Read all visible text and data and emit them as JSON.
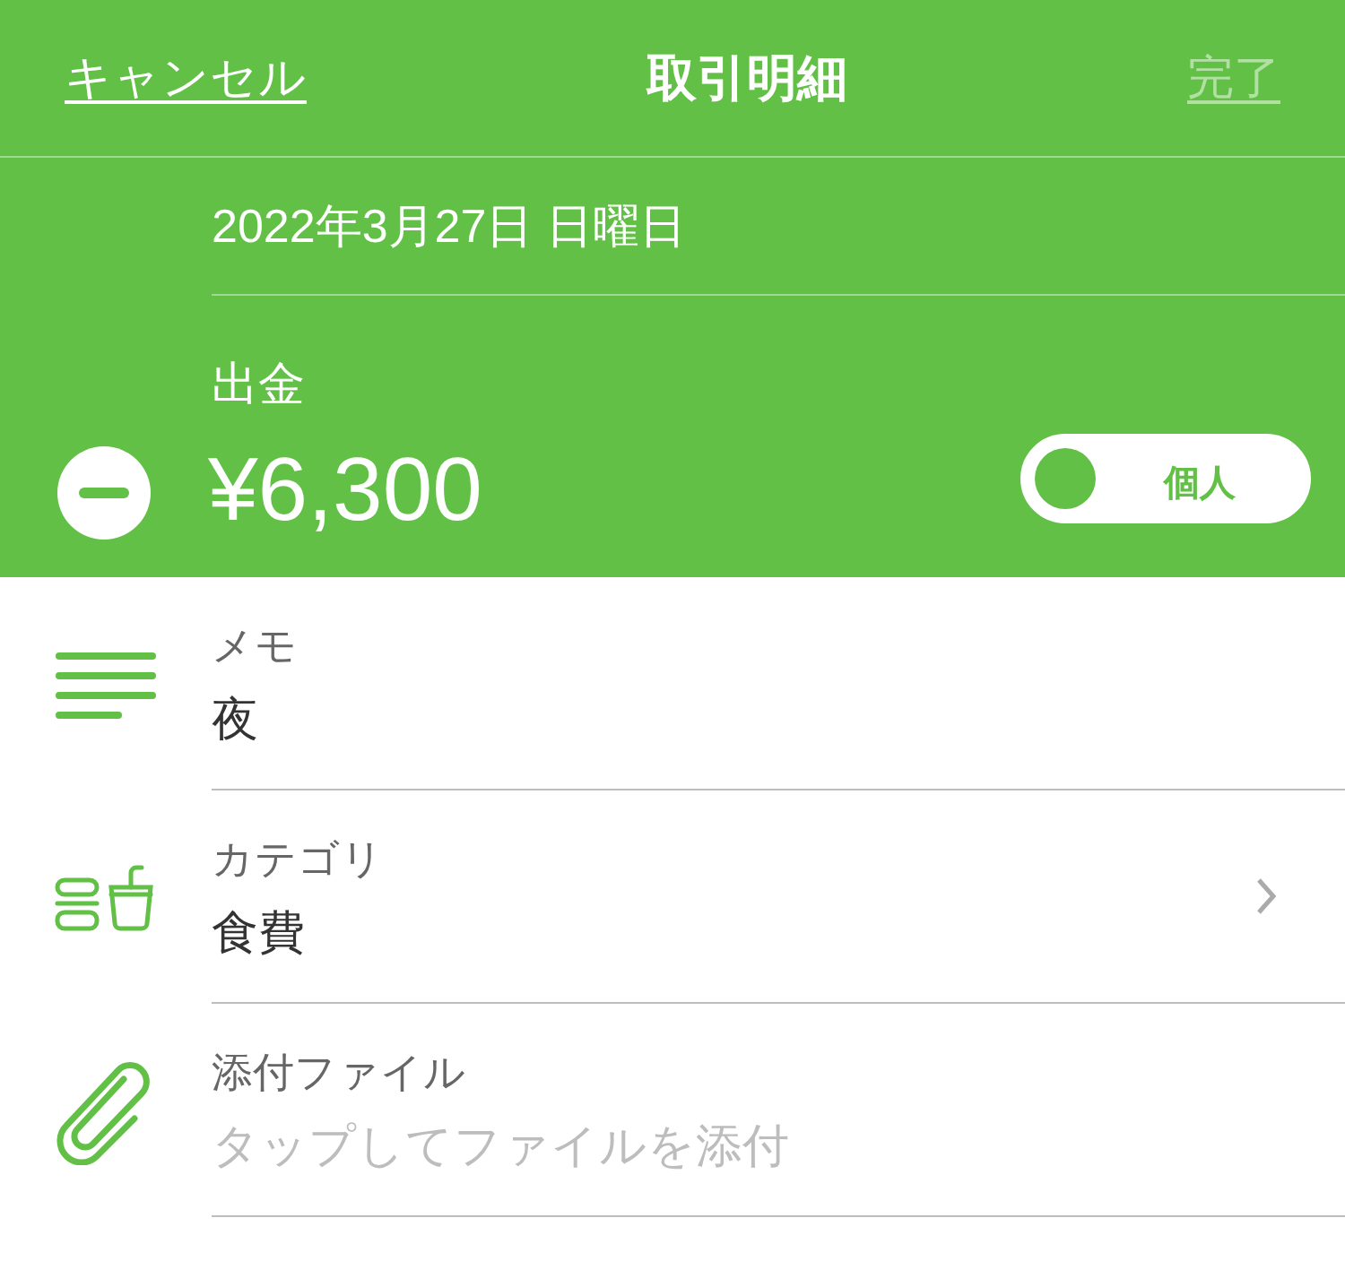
{
  "nav": {
    "cancel": "キャンセル",
    "title": "取引明細",
    "done": {
      "label": "完了",
      "disabled": true
    }
  },
  "date": "2022年3月27日 日曜日",
  "amount": {
    "type_label": "出金",
    "value": "¥6,300",
    "expense": true
  },
  "account_toggle": {
    "label": "個人",
    "on": false
  },
  "rows": [
    {
      "kind": "memo",
      "label": "メモ",
      "value": "夜"
    },
    {
      "kind": "category",
      "label": "カテゴリ",
      "value": "食費"
    },
    {
      "kind": "attachment",
      "label": "添付ファイル",
      "placeholder": "タップしてファイルを添付"
    }
  ]
}
